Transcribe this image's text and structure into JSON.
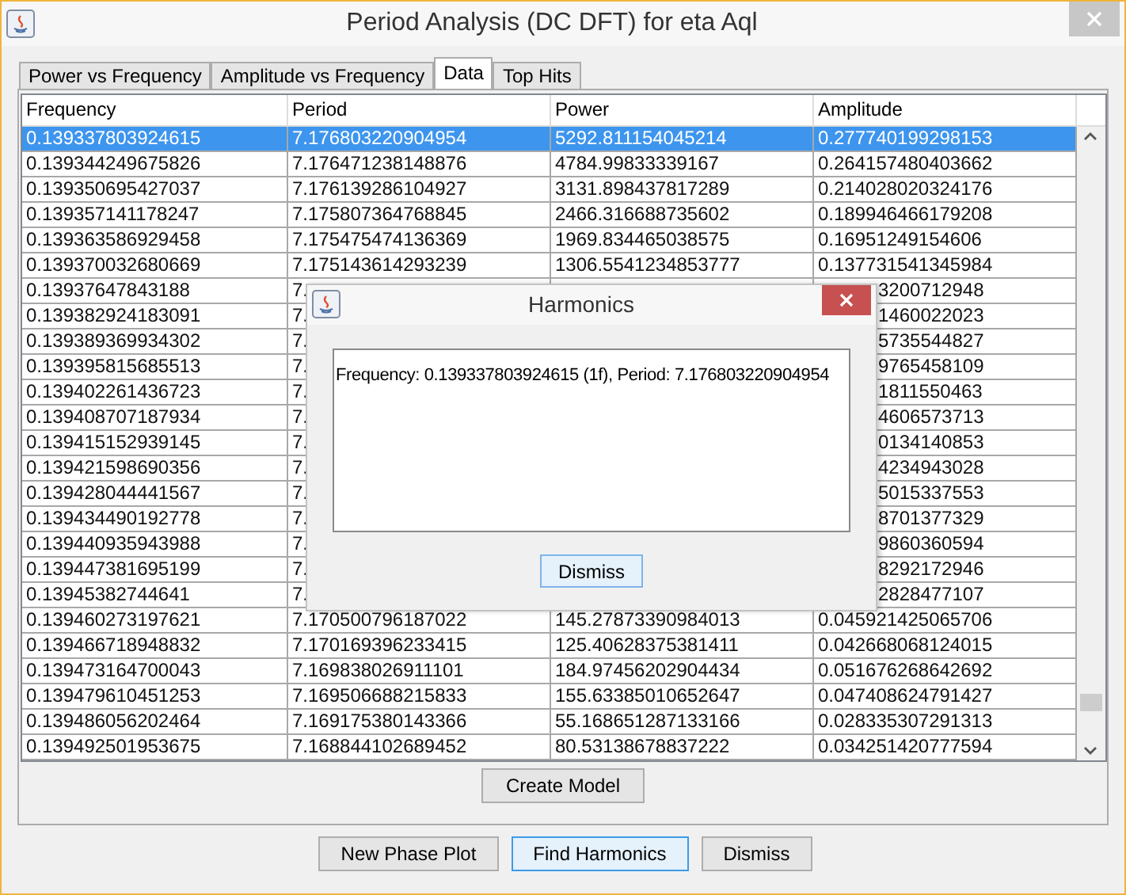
{
  "window": {
    "title": "Period Analysis (DC DFT) for eta Aql"
  },
  "tabs": [
    {
      "label": "Power vs Frequency",
      "selected": false
    },
    {
      "label": "Amplitude vs Frequency",
      "selected": false
    },
    {
      "label": "Data",
      "selected": true
    },
    {
      "label": "Top Hits",
      "selected": false
    }
  ],
  "table": {
    "columns": [
      "Frequency",
      "Period",
      "Power",
      "Amplitude"
    ],
    "rows": [
      {
        "kind": "full",
        "selected": true,
        "frequency": "0.139337803924615",
        "period": "7.176803220904954",
        "power": "5292.811154045214",
        "amplitude": "0.277740199298153"
      },
      {
        "kind": "full",
        "selected": false,
        "frequency": "0.139344249675826",
        "period": "7.176471238148876",
        "power": "4784.99833339167",
        "amplitude": "0.264157480403662"
      },
      {
        "kind": "full",
        "selected": false,
        "frequency": "0.139350695427037",
        "period": "7.176139286104927",
        "power": "3131.898437817289",
        "amplitude": "0.214028020324176"
      },
      {
        "kind": "full",
        "selected": false,
        "frequency": "0.139357141178247",
        "period": "7.175807364768845",
        "power": "2466.316688735602",
        "amplitude": "0.189946466179208"
      },
      {
        "kind": "full",
        "selected": false,
        "frequency": "0.139363586929458",
        "period": "7.175475474136369",
        "power": "1969.834465038575",
        "amplitude": "0.16951249154606"
      },
      {
        "kind": "full",
        "selected": false,
        "frequency": "0.139370032680669",
        "period": "7.175143614293239",
        "power": "1306.5541234853777",
        "amplitude": "0.137731541345984"
      },
      {
        "kind": "covered",
        "selected": false,
        "frequency": "0.13937647843188",
        "period": "7.",
        "amplitude": "3200712948"
      },
      {
        "kind": "covered",
        "selected": false,
        "frequency": "0.139382924183091",
        "period": "7.",
        "amplitude": "1460022023"
      },
      {
        "kind": "covered",
        "selected": false,
        "frequency": "0.139389369934302",
        "period": "7.",
        "amplitude": "5735544827"
      },
      {
        "kind": "covered",
        "selected": false,
        "frequency": "0.139395815685513",
        "period": "7.",
        "amplitude": "9765458109"
      },
      {
        "kind": "covered",
        "selected": false,
        "frequency": "0.139402261436723",
        "period": "7.",
        "amplitude": "1811550463"
      },
      {
        "kind": "covered",
        "selected": false,
        "frequency": "0.139408707187934",
        "period": "7.",
        "amplitude": "4606573713"
      },
      {
        "kind": "covered",
        "selected": false,
        "frequency": "0.139415152939145",
        "period": "7.",
        "amplitude": "0134140853"
      },
      {
        "kind": "covered",
        "selected": false,
        "frequency": "0.139421598690356",
        "period": "7.",
        "amplitude": "4234943028"
      },
      {
        "kind": "covered",
        "selected": false,
        "frequency": "0.139428044441567",
        "period": "7.",
        "amplitude": "5015337553"
      },
      {
        "kind": "covered",
        "selected": false,
        "frequency": "0.139434490192778",
        "period": "7.",
        "amplitude": "8701377329"
      },
      {
        "kind": "covered",
        "selected": false,
        "frequency": "0.139440935943988",
        "period": "7.",
        "amplitude": "9860360594"
      },
      {
        "kind": "covered",
        "selected": false,
        "frequency": "0.139447381695199",
        "period": "7.",
        "amplitude": "8292172946"
      },
      {
        "kind": "covered",
        "selected": false,
        "frequency": "0.13945382744641",
        "period": "7.",
        "amplitude": "2828477107"
      },
      {
        "kind": "full",
        "selected": false,
        "frequency": "0.139460273197621",
        "period": "7.170500796187022",
        "power": "145.27873390984013",
        "amplitude": "0.045921425065706"
      },
      {
        "kind": "full",
        "selected": false,
        "frequency": "0.139466718948832",
        "period": "7.170169396233415",
        "power": "125.40628375381411",
        "amplitude": "0.042668068124015"
      },
      {
        "kind": "full",
        "selected": false,
        "frequency": "0.139473164700043",
        "period": "7.169838026911101",
        "power": "184.97456202904434",
        "amplitude": "0.051676268642692"
      },
      {
        "kind": "full",
        "selected": false,
        "frequency": "0.139479610451253",
        "period": "7.169506688215833",
        "power": "155.63385010652647",
        "amplitude": "0.047408624791427"
      },
      {
        "kind": "full",
        "selected": false,
        "frequency": "0.139486056202464",
        "period": "7.169175380143366",
        "power": "55.168651287133166",
        "amplitude": "0.028335307291313"
      },
      {
        "kind": "full",
        "selected": false,
        "frequency": "0.139492501953675",
        "period": "7.168844102689452",
        "power": "80.53138678837222",
        "amplitude": "0.034251420777594"
      }
    ]
  },
  "create_model_button": "Create Model",
  "buttons": [
    {
      "label": "New Phase Plot",
      "focused": false
    },
    {
      "label": "Find Harmonics",
      "focused": true
    },
    {
      "label": "Dismiss",
      "focused": false
    }
  ],
  "dialog": {
    "title": "Harmonics",
    "text": "Frequency: 0.139337803924615 (1f), Period: 7.176803220904954",
    "button": "Dismiss"
  }
}
